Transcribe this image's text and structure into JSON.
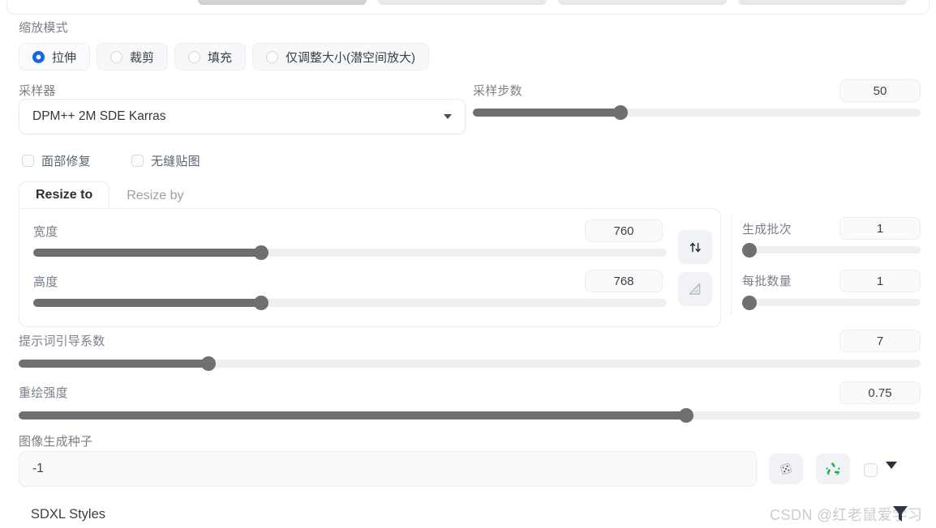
{
  "scale_mode": {
    "label": "缩放模式",
    "options": [
      {
        "label": "拉伸",
        "selected": true
      },
      {
        "label": "裁剪",
        "selected": false
      },
      {
        "label": "填充",
        "selected": false
      },
      {
        "label": "仅调整大小(潜空间放大)",
        "selected": false
      }
    ]
  },
  "sampler": {
    "label": "采样器",
    "value": "DPM++ 2M SDE Karras"
  },
  "steps": {
    "label": "采样步数",
    "value": "50",
    "percent": 33
  },
  "checkboxes": [
    {
      "label": "面部修复",
      "checked": false
    },
    {
      "label": "无缝贴图",
      "checked": false
    }
  ],
  "resize_tabs": [
    {
      "label": "Resize to",
      "active": true
    },
    {
      "label": "Resize by",
      "active": false
    }
  ],
  "width": {
    "label": "宽度",
    "value": "760",
    "percent": 36
  },
  "height": {
    "label": "高度",
    "value": "768",
    "percent": 36
  },
  "swap_button": {
    "icon": "swap-vertical-icon"
  },
  "aspect_button": {
    "icon": "triangle-ruler-icon"
  },
  "batch_count": {
    "label": "生成批次",
    "value": "1",
    "percent": 0
  },
  "batch_size": {
    "label": "每批数量",
    "value": "1",
    "percent": 0
  },
  "cfg": {
    "label": "提示词引导系数",
    "value": "7",
    "percent": 21
  },
  "denoise": {
    "label": "重绘强度",
    "value": "0.75",
    "percent": 74
  },
  "seed": {
    "label": "图像生成种子",
    "value": "-1",
    "dice_icon": "dice-icon",
    "recycle_icon": "recycle-icon",
    "extra_checkbox_checked": false,
    "caret_icon": "caret-down-icon"
  },
  "sdxl_styles": {
    "label": "SDXL Styles"
  },
  "watermark": {
    "text": "CSDN @红老鼠爱学习",
    "icon": "funnel-icon"
  },
  "colors": {
    "accent_blue": "#1068e3",
    "slider_fill": "#6f6f6f",
    "slider_track": "#efefef",
    "label_gray": "#7a7f8a",
    "recycle_green": "#1db954"
  }
}
